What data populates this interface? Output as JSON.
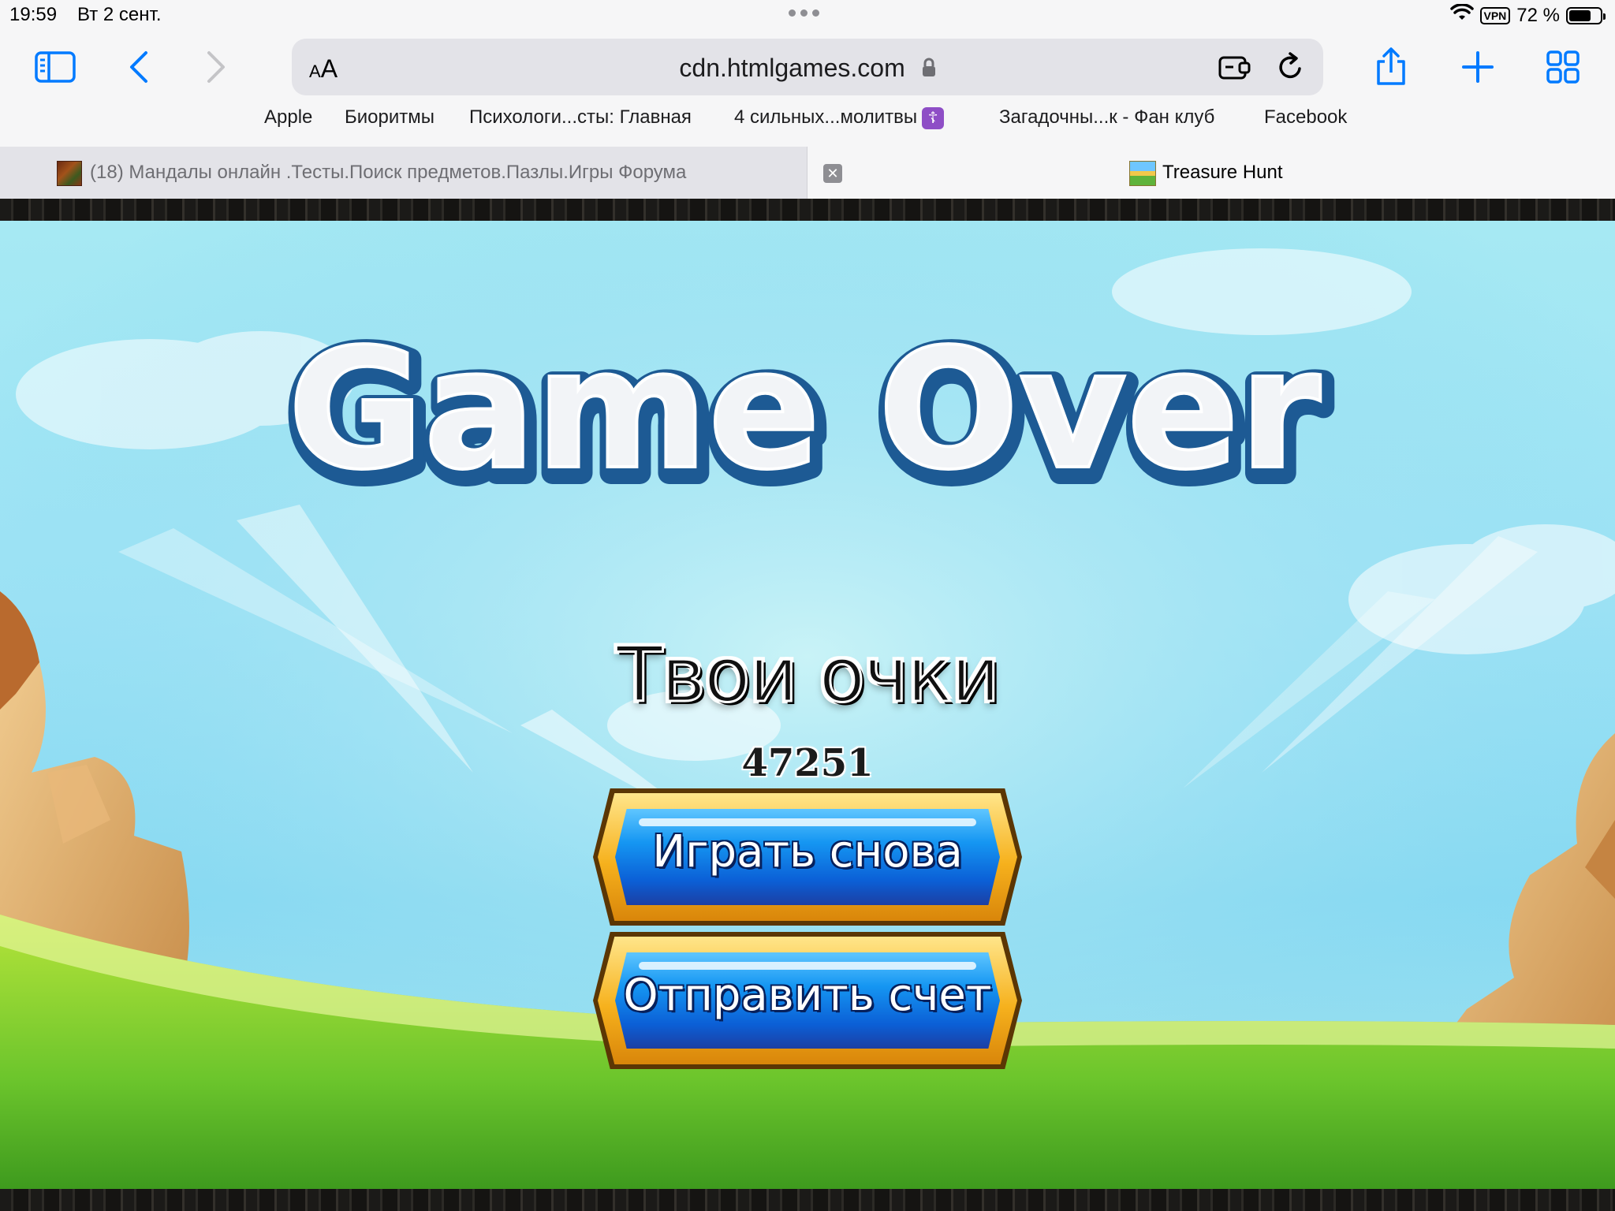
{
  "status_bar": {
    "time": "19:59",
    "date": "Вт 2 сент.",
    "vpn": "VPN",
    "battery": "72 %",
    "battery_level": 0.72
  },
  "toolbar": {
    "reader_label_small": "A",
    "reader_label_large": "A",
    "url": "cdn.htmlgames.com"
  },
  "bookmarks": [
    "Apple",
    "Биоритмы",
    "Психологи...сты: Главная",
    "4 сильных...молитвы",
    "Загадочны...к - Фан клуб",
    "Facebook"
  ],
  "bookmark_badge": "☦",
  "tabs": {
    "inactive_title": "(18) Мандалы онлайн .Тесты.Поиск предметов.Пазлы.Игры Форума",
    "close_glyph": "✕",
    "active_title": "Treasure Hunt"
  },
  "game": {
    "title": "Game Over",
    "score_label": "Твои очки",
    "score_value": "47251",
    "play_again_label": "Играть снова",
    "submit_score_label": "Отправить счет"
  },
  "colors": {
    "accent_blue": "#007aff",
    "title_outline": "#1d5a94",
    "button_blue": "#0b5fd6",
    "button_gold": "#f6b11d"
  }
}
